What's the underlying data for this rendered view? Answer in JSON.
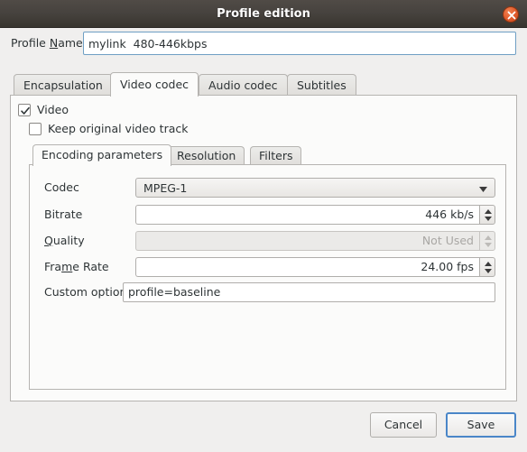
{
  "window": {
    "title": "Profile edition",
    "close_icon": "close-icon"
  },
  "profile": {
    "label_before": "Profile ",
    "label_mnemonic": "N",
    "label_after": "ame",
    "name_value": "mylink  480-446kbps",
    "name_placeholder": "Profile Name"
  },
  "outer_tabs": [
    {
      "label": "Encapsulation",
      "active": false
    },
    {
      "label": "Video codec",
      "active": true
    },
    {
      "label": "Audio codec",
      "active": false
    },
    {
      "label": "Subtitles",
      "active": false
    }
  ],
  "video_checkbox": {
    "label": "Video",
    "checked": true,
    "check_icon": "check-icon"
  },
  "keep_original_checkbox": {
    "label": "Keep original video track",
    "checked": false
  },
  "inner_tabs": [
    {
      "label": "Encoding parameters",
      "active": true
    },
    {
      "label": "Resolution",
      "active": false
    },
    {
      "label": "Filters",
      "active": false
    }
  ],
  "form": {
    "codec": {
      "label": "Codec",
      "value": "MPEG-1",
      "arrow_icon": "chevron-down-icon"
    },
    "bitrate": {
      "label": "Bitrate",
      "value": "446 kb/s",
      "spinner_icon": "spinner-arrows-icon",
      "disabled": false
    },
    "quality": {
      "label_before": "",
      "label_mnemonic": "Q",
      "label_after": "uality",
      "label": "Quality",
      "value": "Not Used",
      "spinner_icon": "spinner-arrows-icon",
      "disabled": true
    },
    "framerate": {
      "label_before": "Fra",
      "label_mnemonic": "m",
      "label_after": "e Rate",
      "label": "Frame Rate",
      "value": "24.00 fps",
      "spinner_icon": "spinner-arrows-icon",
      "disabled": false
    },
    "custom_options": {
      "label": "Custom options",
      "value": "profile=baseline",
      "placeholder": ""
    }
  },
  "actions": {
    "cancel_label": "Cancel",
    "save_label": "Save"
  },
  "colors": {
    "accent": "#4a86c8",
    "close_button": "#e05a2b",
    "titlebar": "#46423e",
    "panel": "#fbfbfa",
    "background": "#f0efee"
  }
}
